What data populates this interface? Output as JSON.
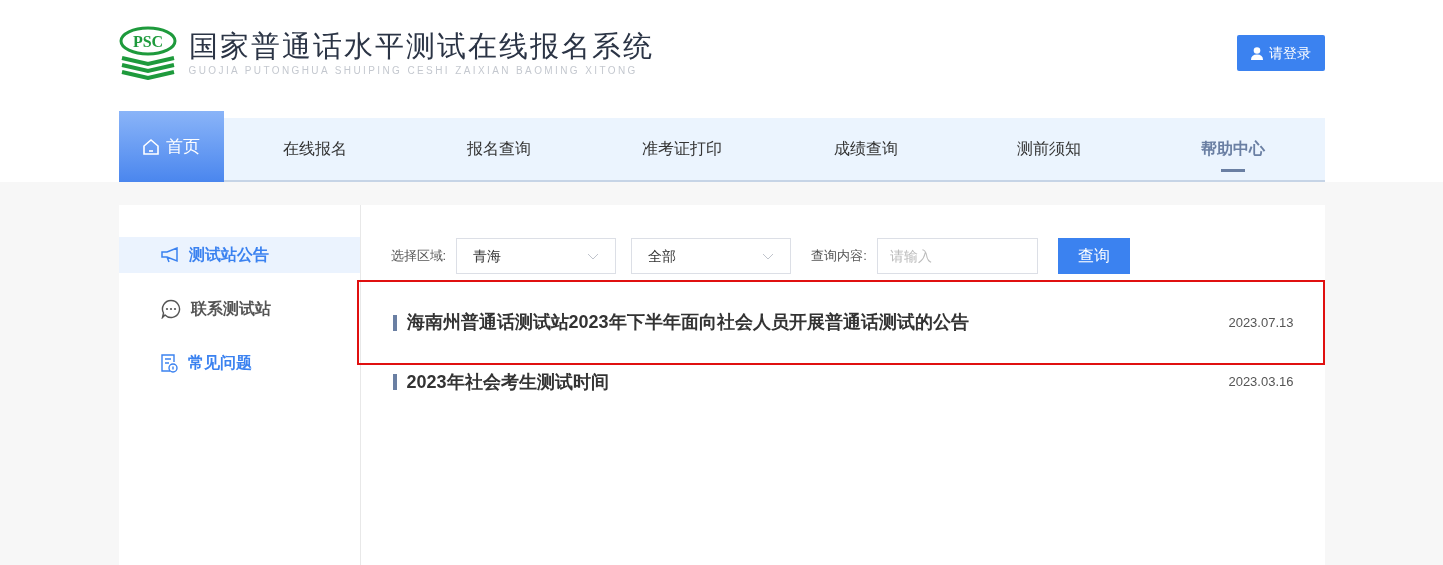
{
  "header": {
    "logo_text": "PSC",
    "title": "国家普通话水平测试在线报名系统",
    "subtitle": "GUOJIA PUTONGHUA SHUIPING CESHI ZAIXIAN BAOMING XITONG",
    "login_button": "请登录"
  },
  "nav": [
    {
      "label": "首页",
      "kind": "home",
      "selected": false
    },
    {
      "label": "在线报名",
      "kind": "link",
      "selected": false
    },
    {
      "label": "报名查询",
      "kind": "link",
      "selected": false
    },
    {
      "label": "准考证打印",
      "kind": "link",
      "selected": false
    },
    {
      "label": "成绩查询",
      "kind": "link",
      "selected": false
    },
    {
      "label": "测前须知",
      "kind": "link",
      "selected": false
    },
    {
      "label": "帮助中心",
      "kind": "link",
      "selected": true
    }
  ],
  "sidebar": {
    "items": [
      {
        "label": "测试站公告",
        "kind": "megaphone",
        "selected": true,
        "highlighted": true
      },
      {
        "label": "联系测试站",
        "kind": "chat",
        "selected": false,
        "highlighted": false
      },
      {
        "label": "常见问题",
        "kind": "faq",
        "selected": false,
        "highlighted": true
      }
    ]
  },
  "filter": {
    "region_label": "选择区域:",
    "region_value": "青海",
    "scope_value": "全部",
    "query_label": "查询内容:",
    "query_placeholder": "请输入",
    "search_button": "查询"
  },
  "notices": [
    {
      "title": "海南州普通话测试站2023年下半年面向社会人员开展普通话测试的公告",
      "date": "2023.07.13",
      "outlined": true
    },
    {
      "title": "2023年社会考生测试时间",
      "date": "2023.03.16",
      "outlined": false
    }
  ]
}
